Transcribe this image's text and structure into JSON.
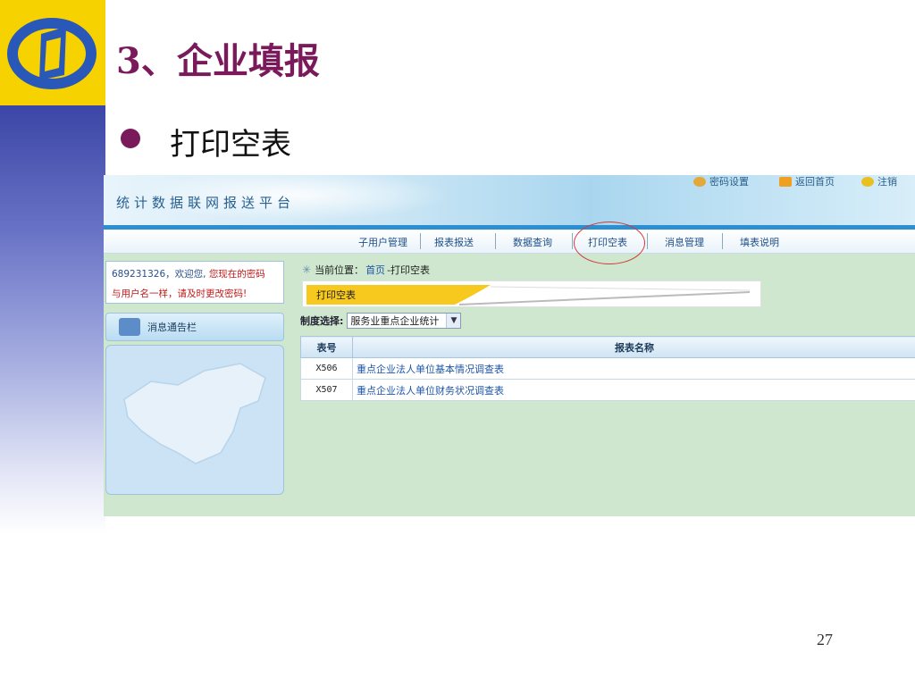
{
  "slide": {
    "title": "3、企业填报",
    "bullet": "打印空表",
    "page_number": "27"
  },
  "platform": {
    "title": "统计数据联网报送平台",
    "links": {
      "password": "密码设置",
      "home": "返回首页",
      "logout": "注销"
    }
  },
  "nav": {
    "items": [
      "子用户管理",
      "报表报送",
      "数据查询",
      "打印空表",
      "消息管理",
      "填表说明"
    ],
    "highlighted": "打印空表"
  },
  "sidebar": {
    "user_id": "689231326",
    "welcome": "，欢迎您,",
    "warning_line1": "您现在的密码",
    "warning_line2": "与用户名一样，请及时更改密码!",
    "notice_title": "消息通告栏"
  },
  "content": {
    "location_label": "当前位置：",
    "location_home": "首页",
    "location_current": "-打印空表",
    "tab_label": "打印空表",
    "system_label": "制度选择:",
    "system_value": "服务业重点企业统计",
    "table": {
      "headers": [
        "表号",
        "报表名称"
      ],
      "rows": [
        {
          "code": "X506",
          "name": "重点企业法人单位基本情况调查表"
        },
        {
          "code": "X507",
          "name": "重点企业法人单位财务状况调查表"
        }
      ]
    }
  },
  "colors": {
    "title": "#7b1a5a",
    "logo_yellow": "#f5d200",
    "side_bar_blue": "#3b46a6",
    "screenshot_bg": "#cfe6cf",
    "highlight_circle": "#d23a3a"
  }
}
